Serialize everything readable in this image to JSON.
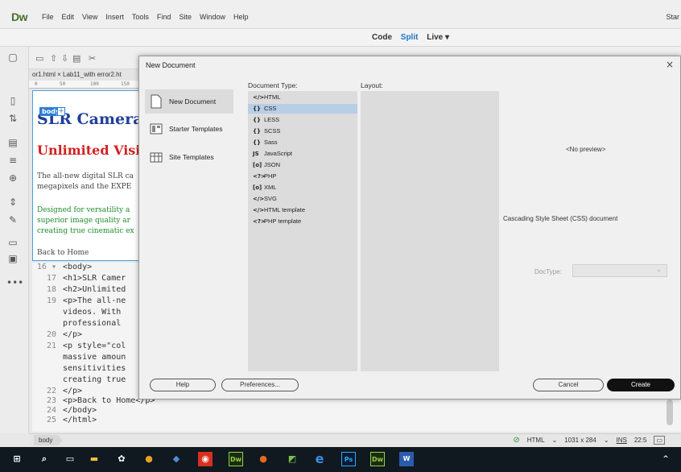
{
  "app": {
    "logo": "Dw",
    "menu": [
      "File",
      "Edit",
      "View",
      "Insert",
      "Tools",
      "Find",
      "Site",
      "Window",
      "Help"
    ],
    "start": "Star"
  },
  "view_switch": {
    "code": "Code",
    "split": "Split",
    "live": "Live ▾"
  },
  "doc_tabs": "or1.html  ×   Lab11_with error2.ht",
  "ruler": [
    "0",
    "50",
    "100",
    "150"
  ],
  "design_view": {
    "body_tag": "body",
    "plus": "+",
    "h1": "SLR Camera",
    "h2": "Unlimited Visio",
    "p1_line1": "The all-new digital SLR ca",
    "p1_line2": "megapixels and the EXPE",
    "p2_line1": "Designed for versatility a",
    "p2_line2": "superior image quality ar",
    "p2_line3": "creating true cinematic ex",
    "p3": "Back to Home"
  },
  "code_view": {
    "lines": [
      {
        "num": "16 ▾",
        "text": "<body>"
      },
      {
        "num": "17",
        "text": "<h1>SLR Camer"
      },
      {
        "num": "18",
        "text": "<h2>Unlimited"
      },
      {
        "num": "19",
        "text": "<p>The all-ne"
      },
      {
        "num": "",
        "text": "videos. With"
      },
      {
        "num": "",
        "text": "professional"
      },
      {
        "num": "20",
        "text": "</p>"
      },
      {
        "num": "21",
        "text": "<p style=\"col"
      },
      {
        "num": "",
        "text": "massive amoun"
      },
      {
        "num": "",
        "text": "sensitivities"
      },
      {
        "num": "",
        "text": "creating true"
      },
      {
        "num": "22",
        "text": "</p>"
      },
      {
        "num": "23",
        "text": "<p>Back to Home</p>"
      },
      {
        "num": "24",
        "text": "</body>"
      },
      {
        "num": "25",
        "text": "</html>"
      }
    ]
  },
  "status": {
    "tag": "body",
    "language": "HTML",
    "size": "1031 x 284",
    "ins": "INS",
    "pos": "22:5"
  },
  "dialog": {
    "title": "New Document",
    "close": "×",
    "categories": [
      {
        "label": "New Document"
      },
      {
        "label": "Starter Templates"
      },
      {
        "label": "Site Templates"
      }
    ],
    "doc_type_header": "Document Type:",
    "layout_header": "Layout:",
    "doc_types": [
      {
        "glyph": "</>",
        "label": "HTML"
      },
      {
        "glyph": "{}",
        "label": "CSS"
      },
      {
        "glyph": "{}",
        "label": "LESS"
      },
      {
        "glyph": "{}",
        "label": "SCSS"
      },
      {
        "glyph": "{}",
        "label": "Sass"
      },
      {
        "glyph": "JS",
        "label": "JavaScript"
      },
      {
        "glyph": "[o]",
        "label": "JSON"
      },
      {
        "glyph": "<?>",
        "label": "PHP"
      },
      {
        "glyph": "[o]",
        "label": "XML"
      },
      {
        "glyph": "</>",
        "label": "SVG"
      },
      {
        "glyph": "</>",
        "label": "HTML template"
      },
      {
        "glyph": "<?>",
        "label": "PHP template"
      }
    ],
    "selected_doc_type_index": 1,
    "preview": "<No preview>",
    "description": "Cascading Style Sheet (CSS) document",
    "doctype_label": "DocType:",
    "buttons": {
      "help": "Help",
      "preferences": "Preferences...",
      "cancel": "Cancel",
      "create": "Create"
    }
  },
  "colors": {
    "accent": "#1b74c5",
    "h1": "#1f3f99",
    "h2": "#d42020",
    "green_text": "#1d8a2b",
    "selection": "#b8cde6",
    "taskbar": "#101820"
  }
}
